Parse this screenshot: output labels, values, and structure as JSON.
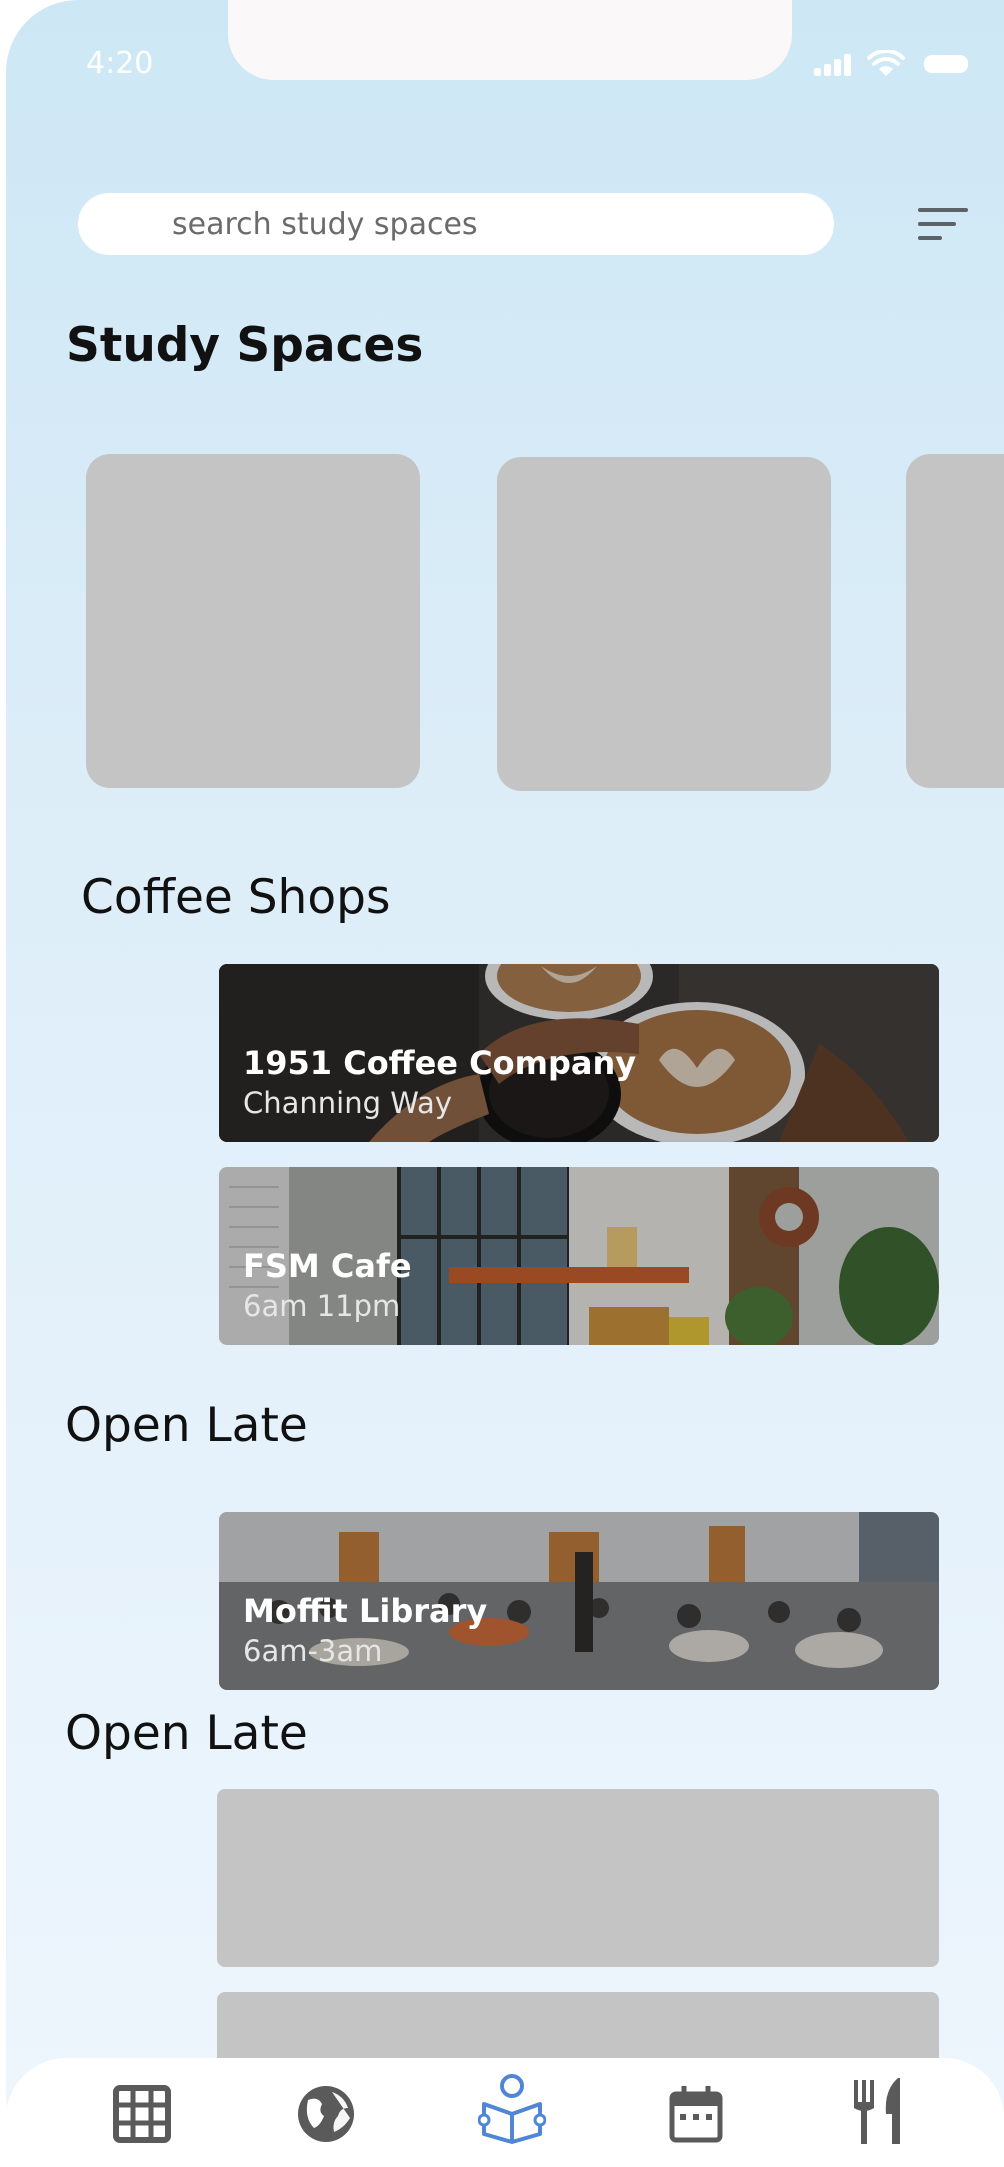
{
  "status_bar": {
    "time": "4:20"
  },
  "search": {
    "placeholder": "search study spaces",
    "icon": "filter-icon"
  },
  "page_title": "Study Spaces",
  "sections": [
    {
      "title": "Coffee Shops",
      "cards": [
        {
          "name": "1951 Coffee Company",
          "subtitle": "Channing Way",
          "image": "coffee-cups-photo"
        },
        {
          "name": "FSM Cafe",
          "subtitle": "6am 11pm",
          "image": "cafe-interior-photo"
        }
      ]
    },
    {
      "title": "Open Late",
      "cards": [
        {
          "name": "Moffit Library",
          "subtitle": "6am-3am",
          "image": "library-interior-photo"
        }
      ]
    },
    {
      "title": "Open Late"
    }
  ],
  "bottom_nav": {
    "items": [
      {
        "icon": "grid-icon",
        "active": false
      },
      {
        "icon": "globe-icon",
        "active": false
      },
      {
        "icon": "study-reader-icon",
        "active": true
      },
      {
        "icon": "calendar-icon",
        "active": false
      },
      {
        "icon": "dining-icon",
        "active": false
      }
    ],
    "colors": {
      "inactive": "#5a5a5a",
      "active": "#4f86d6"
    }
  },
  "colors": {
    "background_top": "#cde7f5",
    "background_bottom": "#eef6fd",
    "placeholder_gray": "#c4c4c4"
  }
}
